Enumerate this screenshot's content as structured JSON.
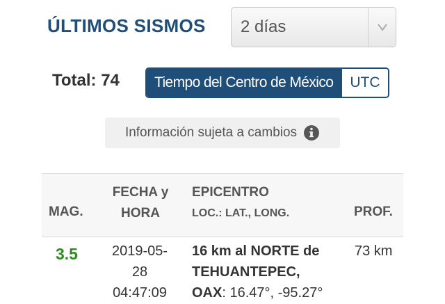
{
  "header": {
    "title": "ÚLTIMOS SISMOS",
    "period_select": {
      "value": "2 días"
    }
  },
  "summary": {
    "total_label": "Total: 74",
    "time_toggle": {
      "options": [
        "Tiempo del Centro de México",
        "UTC"
      ],
      "selected": "Tiempo del Centro de México"
    }
  },
  "notice": {
    "text": "Información sujeta a cambios",
    "icon": "info-icon"
  },
  "table": {
    "headers": {
      "magnitude": "MAG.",
      "datetime_line1": "FECHA y",
      "datetime_line2": "HORA",
      "epicenter": "EPICENTRO",
      "epicenter_sub": "LOC.: LAT., LONG.",
      "depth": "PROF."
    },
    "rows": [
      {
        "magnitude": "3.5",
        "date": "2019-05-28",
        "date_line1": "2019-05-",
        "date_line2": "28",
        "time": "04:47:09",
        "location_line1": "16 km al NORTE de",
        "location_line2": "TEHUANTEPEC,",
        "location_line3": "OAX",
        "coords": ": 16.47°, -95.27°",
        "depth": "73 km"
      }
    ]
  },
  "colors": {
    "primary": "#1f4e79",
    "magnitude_green": "#2e8b20",
    "notice_bg": "#f0f0f0"
  }
}
